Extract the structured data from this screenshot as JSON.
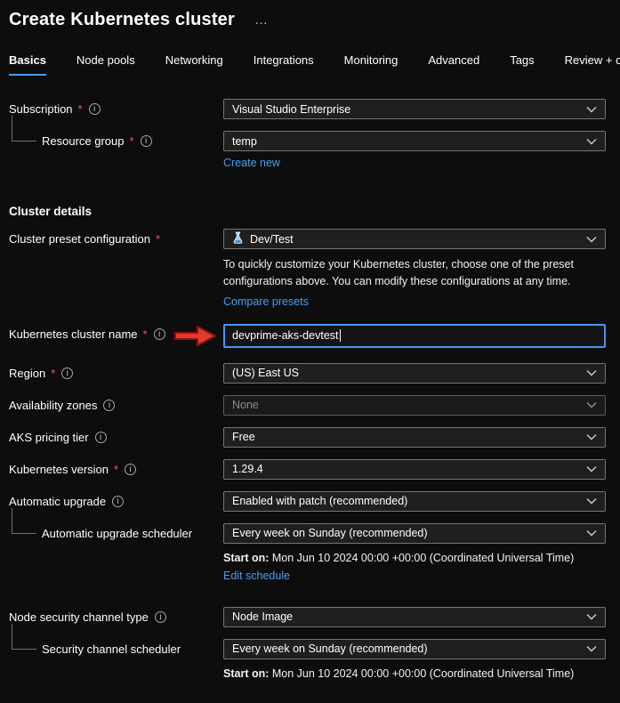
{
  "colors": {
    "background": "#0d0d0d",
    "accent_blue": "#479ef5",
    "link_blue": "#479ef5",
    "required_red": "#f15d5d",
    "annotation_arrow_red": "#e23a2a"
  },
  "ui": {
    "required_marker": "*",
    "info_glyph": "i"
  },
  "header": {
    "title": "Create Kubernetes cluster",
    "more": "…"
  },
  "tabs": {
    "items": [
      {
        "label": "Basics",
        "active": true
      },
      {
        "label": "Node pools",
        "active": false
      },
      {
        "label": "Networking",
        "active": false
      },
      {
        "label": "Integrations",
        "active": false
      },
      {
        "label": "Monitoring",
        "active": false
      },
      {
        "label": "Advanced",
        "active": false
      },
      {
        "label": "Tags",
        "active": false
      },
      {
        "label": "Review + create",
        "active": false
      }
    ]
  },
  "basics": {
    "subscription": {
      "label": "Subscription",
      "value": "Visual Studio Enterprise"
    },
    "resource_group": {
      "label": "Resource group",
      "value": "temp",
      "create_new": "Create new"
    },
    "cluster_details_heading": "Cluster details",
    "preset": {
      "label": "Cluster preset configuration",
      "value": "Dev/Test",
      "description": "To quickly customize your Kubernetes cluster, choose one of the preset configurations above. You can modify these configurations at any time.",
      "compare_link": "Compare presets"
    },
    "cluster_name": {
      "label": "Kubernetes cluster name",
      "value": "devprime-aks-devtest"
    },
    "region": {
      "label": "Region",
      "value": "(US) East US"
    },
    "availability_zones": {
      "label": "Availability zones",
      "value": "None"
    },
    "pricing_tier": {
      "label": "AKS pricing tier",
      "value": "Free"
    },
    "version": {
      "label": "Kubernetes version",
      "value": "1.29.4"
    },
    "auto_upgrade": {
      "label": "Automatic upgrade",
      "value": "Enabled with patch (recommended)"
    },
    "auto_upgrade_scheduler": {
      "label": "Automatic upgrade scheduler",
      "value": "Every week on Sunday (recommended)",
      "start_on_label": "Start on:",
      "start_on_value": " Mon Jun 10 2024 00:00 +00:00 (Coordinated Universal Time)",
      "edit_link": "Edit schedule"
    },
    "security_channel": {
      "label": "Node security channel type",
      "value": "Node Image"
    },
    "security_scheduler": {
      "label": "Security channel scheduler",
      "value": "Every week on Sunday (recommended)",
      "start_on_label": "Start on:",
      "start_on_value": " Mon Jun 10 2024 00:00 +00:00 (Coordinated Universal Time)"
    }
  }
}
